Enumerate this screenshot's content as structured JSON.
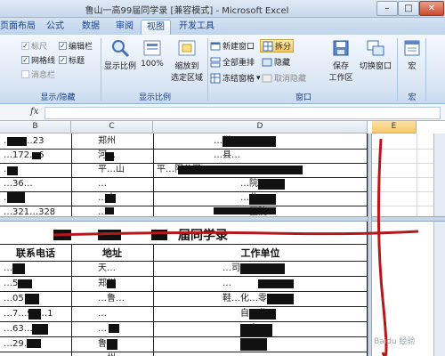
{
  "window": {
    "title": "鲁山一高99届同学录  [兼容模式] - Microsoft Excel",
    "min_label": "–",
    "max_label": "□",
    "close_label": "✕"
  },
  "tabs": [
    {
      "label": "页面布局",
      "active": false
    },
    {
      "label": "公式",
      "active": false
    },
    {
      "label": "数据",
      "active": false
    },
    {
      "label": "审阅",
      "active": false
    },
    {
      "label": "视图",
      "active": true
    },
    {
      "label": "开发工具",
      "active": false
    }
  ],
  "ribbon": {
    "show_hide": {
      "ruler": {
        "label": "标尺",
        "checked": true,
        "enabled": false
      },
      "gridlines": {
        "label": "网格线",
        "checked": true,
        "enabled": true
      },
      "message_bar": {
        "label": "消息栏",
        "checked": false,
        "enabled": false
      },
      "formula_bar": {
        "label": "编辑栏",
        "checked": true,
        "enabled": true
      },
      "headings": {
        "label": "标题",
        "checked": true,
        "enabled": true
      },
      "group_label": "显示/隐藏"
    },
    "zoom": {
      "zoom_label": "显示比例",
      "hundred_label": "100%",
      "fit_label_1": "缩放到",
      "fit_label_2": "选定区域",
      "group_label": "显示比例"
    },
    "window": {
      "new_window": "新建窗口",
      "arrange_all": "全部重排",
      "freeze_panes": "冻结窗格",
      "split": "拆分",
      "hide": "隐藏",
      "unhide": "取消隐藏",
      "save_workspace_1": "保存",
      "save_workspace_2": "工作区",
      "switch_windows": "切换窗口",
      "group_label": "窗口"
    },
    "macros": {
      "label": "宏",
      "group_label": "宏"
    }
  },
  "formula": {
    "fx_label": "fx",
    "value": ""
  },
  "sheet": {
    "columns": [
      "B",
      "C",
      "D",
      "E"
    ],
    "selected_column": "E",
    "top_rows": [
      {
        "b": "…14…23",
        "c": "郑州",
        "d": "…学"
      },
      {
        "b": "…172…6",
        "c": "河…",
        "d": "…县…"
      },
      {
        "b": "…",
        "c": "平…山",
        "d": "平…限公司"
      },
      {
        "b": "…36…",
        "c": "…",
        "d": "…院"
      },
      {
        "b": "…",
        "c": "…山",
        "d": "…业"
      },
      {
        "b": "…321…328",
        "c": "…",
        "d": "…医院"
      }
    ],
    "banner_text": "届同学录",
    "headers": {
      "phone": "联系电话",
      "address": "地址",
      "work": "工作单位"
    },
    "bottom_rows": [
      {
        "b": "…5",
        "c": "天…",
        "d": "…司"
      },
      {
        "b": "…56…",
        "c": "郑州",
        "d": "…"
      },
      {
        "b": "…05…",
        "c": "…鲁…",
        "d": "鞋…化…零"
      },
      {
        "b": "…7…99…1",
        "c": "…",
        "d": "自…业"
      },
      {
        "b": "…63…",
        "c": "…",
        "d": "…电"
      },
      {
        "b": "…29…",
        "c": "鲁…",
        "d": "…院"
      },
      {
        "b": "…",
        "c": "…州",
        "d": "…"
      }
    ],
    "watermark": "Baidu 经验"
  }
}
